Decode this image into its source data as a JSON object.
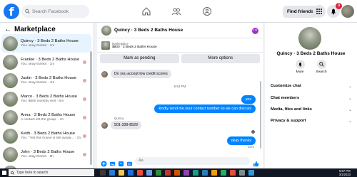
{
  "topbar": {
    "logo": "f",
    "search_placeholder": "Search Facebook",
    "find_friends": "Find friends",
    "notif_count": "3"
  },
  "marketplace": {
    "title": "Marketplace",
    "conversations": [
      {
        "name": "Quincy · 3 Beds 2 Baths House",
        "sub": "You: okay thanks · 1m"
      },
      {
        "name": "Frankie · 3 Beds 2 Baths House",
        "sub": "You: okay thanks · 1m"
      },
      {
        "name": "Justin · 3 Beds 2 Baths House",
        "sub": "You: okay thanks · 4m"
      },
      {
        "name": "Marco · 3 Beds 2 Baths House",
        "sub": "You: $800 monthly rent · 6m"
      },
      {
        "name": "Anna · 3 Beds 2 Baths House",
        "sub": "A contact left the group. · 1h"
      },
      {
        "name": "Keith · 3 Beds 2 Baths House",
        "sub": "You: \"Yes this house is still availa... · 1h"
      },
      {
        "name": "John · 3 Beds 2 Baths House",
        "sub": "You: okay thanks · 8h"
      },
      {
        "name": "Joe · 3 Beds 2 Baths House",
        "sub": ""
      }
    ]
  },
  "chat": {
    "title": "Quincy · 3 Beds 2 Baths House",
    "listing_label": "Marketplace",
    "listing_price": "$800 · 3 Beds 2 Baths House",
    "mark_pending": "Mark as pending",
    "more_options": "More options",
    "messages": {
      "credit": "Do you accept low credit scores",
      "time": "6:54 PM",
      "yes": "yes",
      "kindly": "kindly  send me  your contact number so we can discuss",
      "sender": "Quincy",
      "phone": "501-339-8529",
      "okay": "okay thanks",
      "seen": "Seen"
    },
    "composer_placeholder": "Aa"
  },
  "details": {
    "title": "Quincy · 3 Beds 2 Baths House",
    "mute": "Mute",
    "search": "Search",
    "rows": [
      "Customize chat",
      "Chat members",
      "Media, files and links",
      "Privacy & support"
    ]
  },
  "taskbar": {
    "search_placeholder": "Type here to search",
    "time": "6:57 PM",
    "date": "3/1/2023"
  },
  "colors": {
    "accent": "#1877f2",
    "bubble_out": "#0084ff",
    "badge": "#e41e3f"
  }
}
